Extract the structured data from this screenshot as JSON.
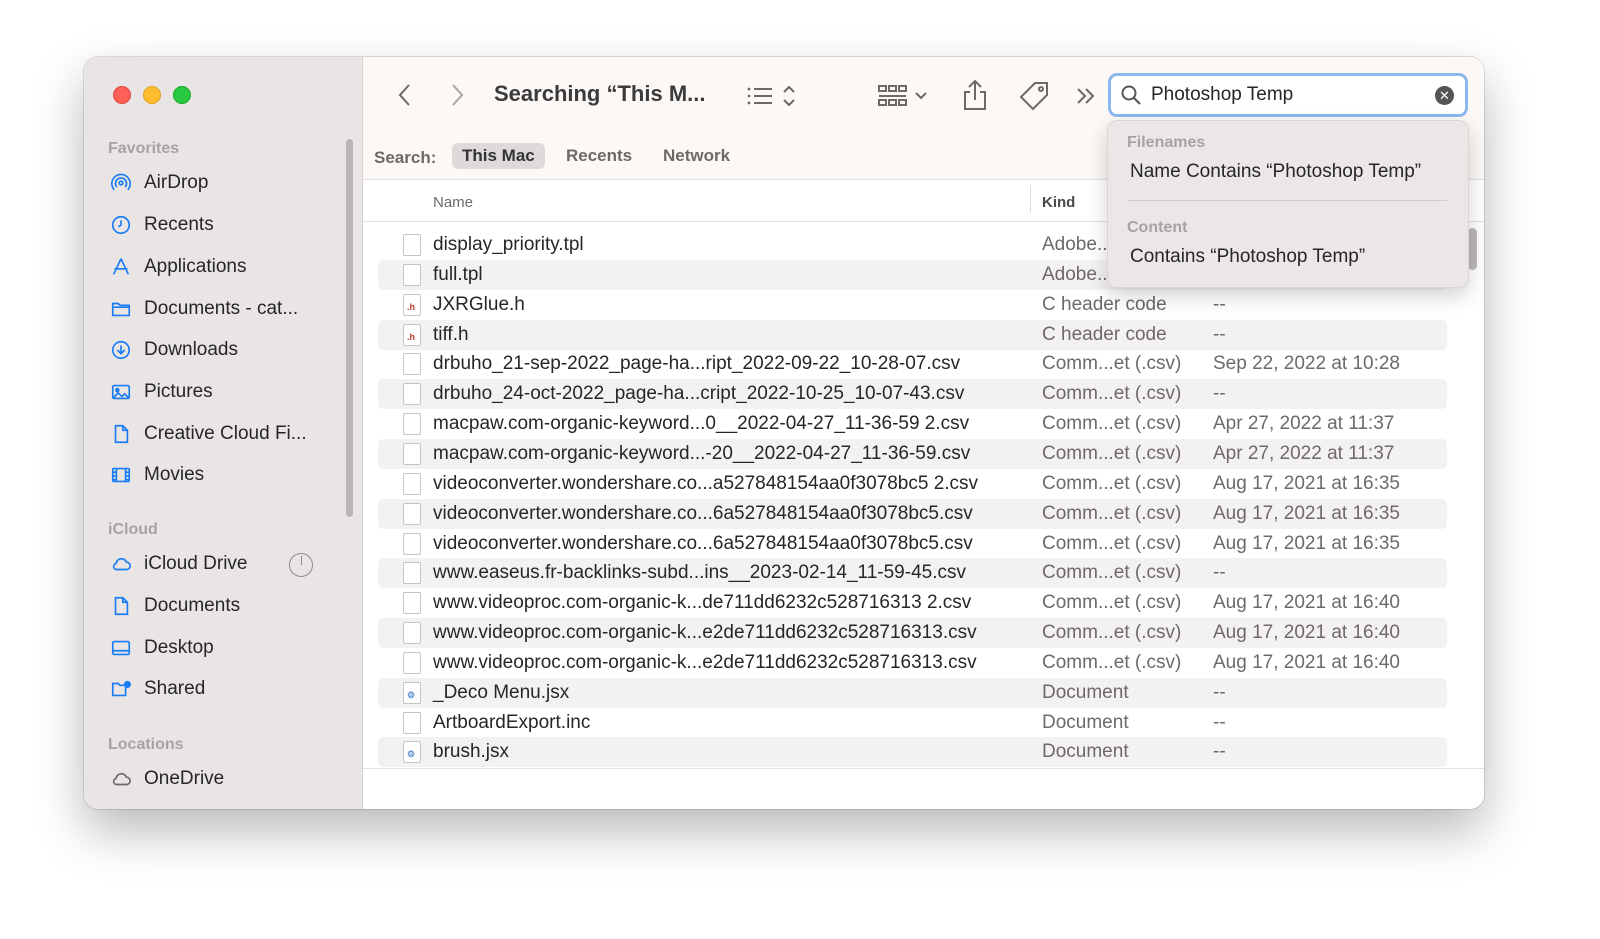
{
  "window": {
    "title": "Searching “This M..."
  },
  "sidebar": {
    "favorites_heading": "Favorites",
    "favorites": [
      {
        "label": "AirDrop",
        "icon": "airdrop-icon"
      },
      {
        "label": "Recents",
        "icon": "clock-icon"
      },
      {
        "label": "Applications",
        "icon": "applications-icon"
      },
      {
        "label": "Documents - cat...",
        "icon": "folder-icon"
      },
      {
        "label": "Downloads",
        "icon": "download-icon"
      },
      {
        "label": "Pictures",
        "icon": "pictures-icon"
      },
      {
        "label": "Creative Cloud Fi...",
        "icon": "document-icon"
      },
      {
        "label": "Movies",
        "icon": "film-icon"
      }
    ],
    "icloud_heading": "iCloud",
    "icloud": [
      {
        "label": "iCloud Drive",
        "icon": "cloud-icon"
      },
      {
        "label": "Documents",
        "icon": "document-icon"
      },
      {
        "label": "Desktop",
        "icon": "desktop-icon"
      },
      {
        "label": "Shared",
        "icon": "shared-folder-icon"
      }
    ],
    "locations_heading": "Locations",
    "locations": [
      {
        "label": "OneDrive",
        "icon": "cloud-icon"
      }
    ]
  },
  "search": {
    "value": "Photoshop Temp"
  },
  "scope": {
    "label": "Search:",
    "this_mac": "This Mac",
    "recents": "Recents",
    "network": "Network"
  },
  "columns": {
    "name": "Name",
    "kind": "Kind"
  },
  "files": [
    {
      "name": "display_priority.tpl",
      "kind": "Adobe...",
      "date": "",
      "badge": "tpl"
    },
    {
      "name": "full.tpl",
      "kind": "Adobe...",
      "date": "",
      "badge": "tpl"
    },
    {
      "name": "JXRGlue.h",
      "kind": "C header code",
      "date": "--",
      "badge": "h"
    },
    {
      "name": "tiff.h",
      "kind": "C header code",
      "date": "--",
      "badge": "h"
    },
    {
      "name": "drbuho_21-sep-2022_page-ha...ript_2022-09-22_10-28-07.csv",
      "kind": "Comm...et (.csv)",
      "date": "Sep 22, 2022 at 10:28",
      "badge": "csv"
    },
    {
      "name": "drbuho_24-oct-2022_page-ha...cript_2022-10-25_10-07-43.csv",
      "kind": "Comm...et (.csv)",
      "date": "--",
      "badge": "csv"
    },
    {
      "name": "macpaw.com-organic-keyword...0__2022-04-27_11-36-59 2.csv",
      "kind": "Comm...et (.csv)",
      "date": "Apr 27, 2022 at 11:37",
      "badge": "csv"
    },
    {
      "name": "macpaw.com-organic-keyword...-20__2022-04-27_11-36-59.csv",
      "kind": "Comm...et (.csv)",
      "date": "Apr 27, 2022 at 11:37",
      "badge": "csv"
    },
    {
      "name": "videoconverter.wondershare.co...a527848154aa0f3078bc5 2.csv",
      "kind": "Comm...et (.csv)",
      "date": "Aug 17, 2021 at 16:35",
      "badge": "csv"
    },
    {
      "name": "videoconverter.wondershare.co...6a527848154aa0f3078bc5.csv",
      "kind": "Comm...et (.csv)",
      "date": "Aug 17, 2021 at 16:35",
      "badge": "csv"
    },
    {
      "name": "videoconverter.wondershare.co...6a527848154aa0f3078bc5.csv",
      "kind": "Comm...et (.csv)",
      "date": "Aug 17, 2021 at 16:35",
      "badge": "csv"
    },
    {
      "name": "www.easeus.fr-backlinks-subd...ins__2023-02-14_11-59-45.csv",
      "kind": "Comm...et (.csv)",
      "date": "--",
      "badge": "csv"
    },
    {
      "name": "www.videoproc.com-organic-k...de711dd6232c528716313 2.csv",
      "kind": "Comm...et (.csv)",
      "date": "Aug 17, 2021 at 16:40",
      "badge": "csv"
    },
    {
      "name": "www.videoproc.com-organic-k...e2de711dd6232c528716313.csv",
      "kind": "Comm...et (.csv)",
      "date": "Aug 17, 2021 at 16:40",
      "badge": "csv"
    },
    {
      "name": "www.videoproc.com-organic-k...e2de711dd6232c528716313.csv",
      "kind": "Comm...et (.csv)",
      "date": "Aug 17, 2021 at 16:40",
      "badge": "csv"
    },
    {
      "name": "_Deco Menu.jsx",
      "kind": "Document",
      "date": "--",
      "badge": "jsx"
    },
    {
      "name": "ArtboardExport.inc",
      "kind": "Document",
      "date": "--",
      "badge": "inc"
    },
    {
      "name": "brush.jsx",
      "kind": "Document",
      "date": "--",
      "badge": "jsx"
    }
  ],
  "suggestions": {
    "filenames_heading": "Filenames",
    "filenames_item": "Name Contains “Photoshop Temp”",
    "content_heading": "Content",
    "content_item": "Contains “Photoshop Temp”"
  },
  "colors": {
    "accent": "#0a7aff",
    "focus_ring": "#8cb8ee",
    "sidebar_bg": "#e9e5e4"
  }
}
